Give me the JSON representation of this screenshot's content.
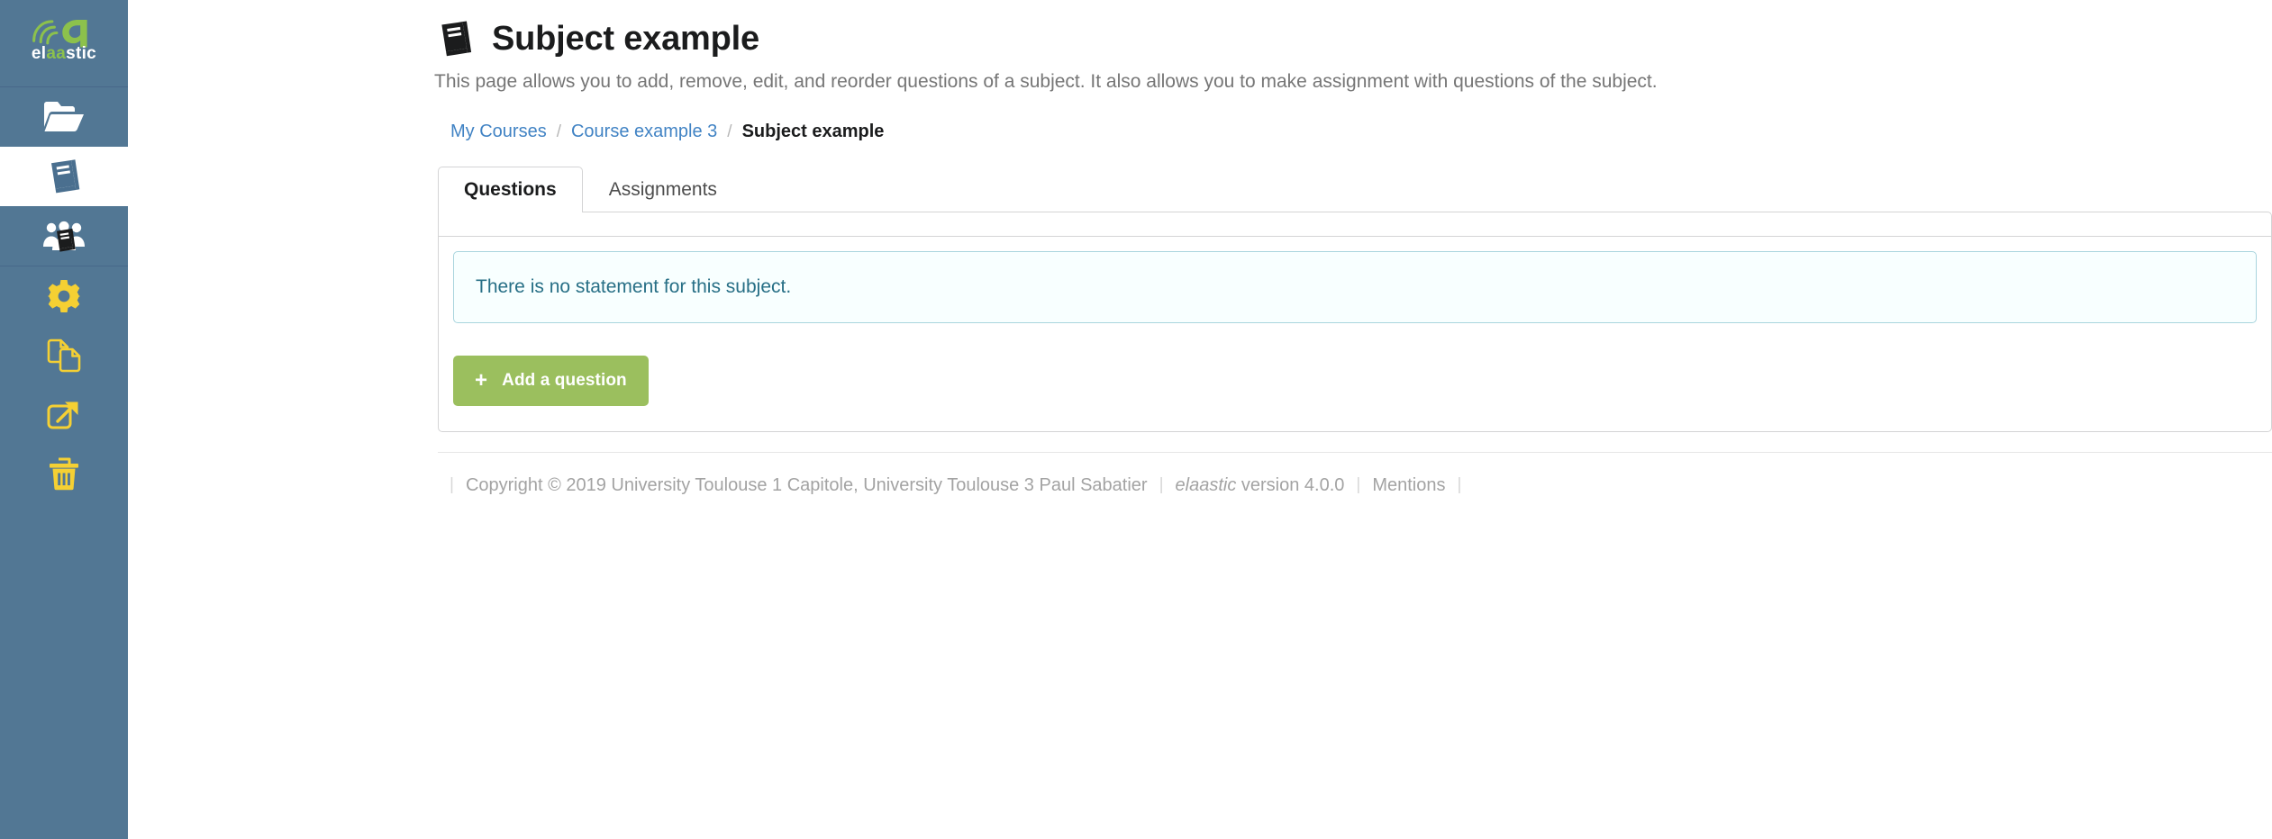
{
  "colors": {
    "sidebar_bg": "#527794",
    "sidebar_divider": "#47688a",
    "logo_green": "#8cc14c",
    "sidebar_icon_white": "#ffffff",
    "sidebar_icon_yellow": "#f5d033",
    "sidebar_icon_active": "#4a6f8f",
    "link_blue": "#4183c4",
    "alert_border": "#a9d5de",
    "alert_bg": "#f8ffff",
    "alert_text": "#276f86",
    "button_green": "#9bbf5e",
    "panel_border": "#d4d4d5",
    "muted_text": "#767676",
    "footer_text": "#a3a3a3"
  },
  "sidebar": {
    "logo": {
      "name": "elaastic-logo",
      "text_parts": [
        "el",
        "aa",
        "stic"
      ],
      "full_text": "elaastic"
    },
    "items": [
      {
        "icon": "open-folder-icon",
        "name": "sidebar-item-courses",
        "active": false,
        "style": "white"
      },
      {
        "icon": "book-icon",
        "name": "sidebar-item-subjects",
        "active": true,
        "style": "active"
      },
      {
        "icon": "shared-subjects-icon",
        "name": "sidebar-item-shared-subjects",
        "active": false,
        "style": "white"
      },
      {
        "icon": "gear-icon",
        "name": "sidebar-item-settings",
        "active": false,
        "style": "yellow"
      },
      {
        "icon": "copy-icon",
        "name": "sidebar-item-duplicate",
        "active": false,
        "style": "yellow"
      },
      {
        "icon": "share-external-link-icon",
        "name": "sidebar-item-share",
        "active": false,
        "style": "yellow"
      },
      {
        "icon": "trash-icon",
        "name": "sidebar-item-delete",
        "active": false,
        "style": "yellow"
      }
    ]
  },
  "header": {
    "icon": "book-title-icon",
    "title": "Subject example",
    "description": "This page allows you to add, remove, edit, and reorder questions of a subject. It also allows you to make assignment with questions of the subject."
  },
  "breadcrumb": {
    "items": [
      {
        "label": "My Courses",
        "active": false
      },
      {
        "label": "Course example 3",
        "active": false
      },
      {
        "label": "Subject example",
        "active": true
      }
    ],
    "separator": "/"
  },
  "tabs": [
    {
      "label": "Questions",
      "active": true
    },
    {
      "label": "Assignments",
      "active": false
    }
  ],
  "content": {
    "alert": {
      "message": "There is no statement for this subject."
    },
    "add_question_button": {
      "label": "Add a question",
      "icon": "plus-icon",
      "plus": "+"
    }
  },
  "footer": {
    "copyright": "Copyright © 2019 University Toulouse 1 Capitole, University Toulouse 3 Paul Sabatier",
    "app_name": "elaastic",
    "version": "version 4.0.0",
    "mentions": "Mentions",
    "separator": "|"
  }
}
